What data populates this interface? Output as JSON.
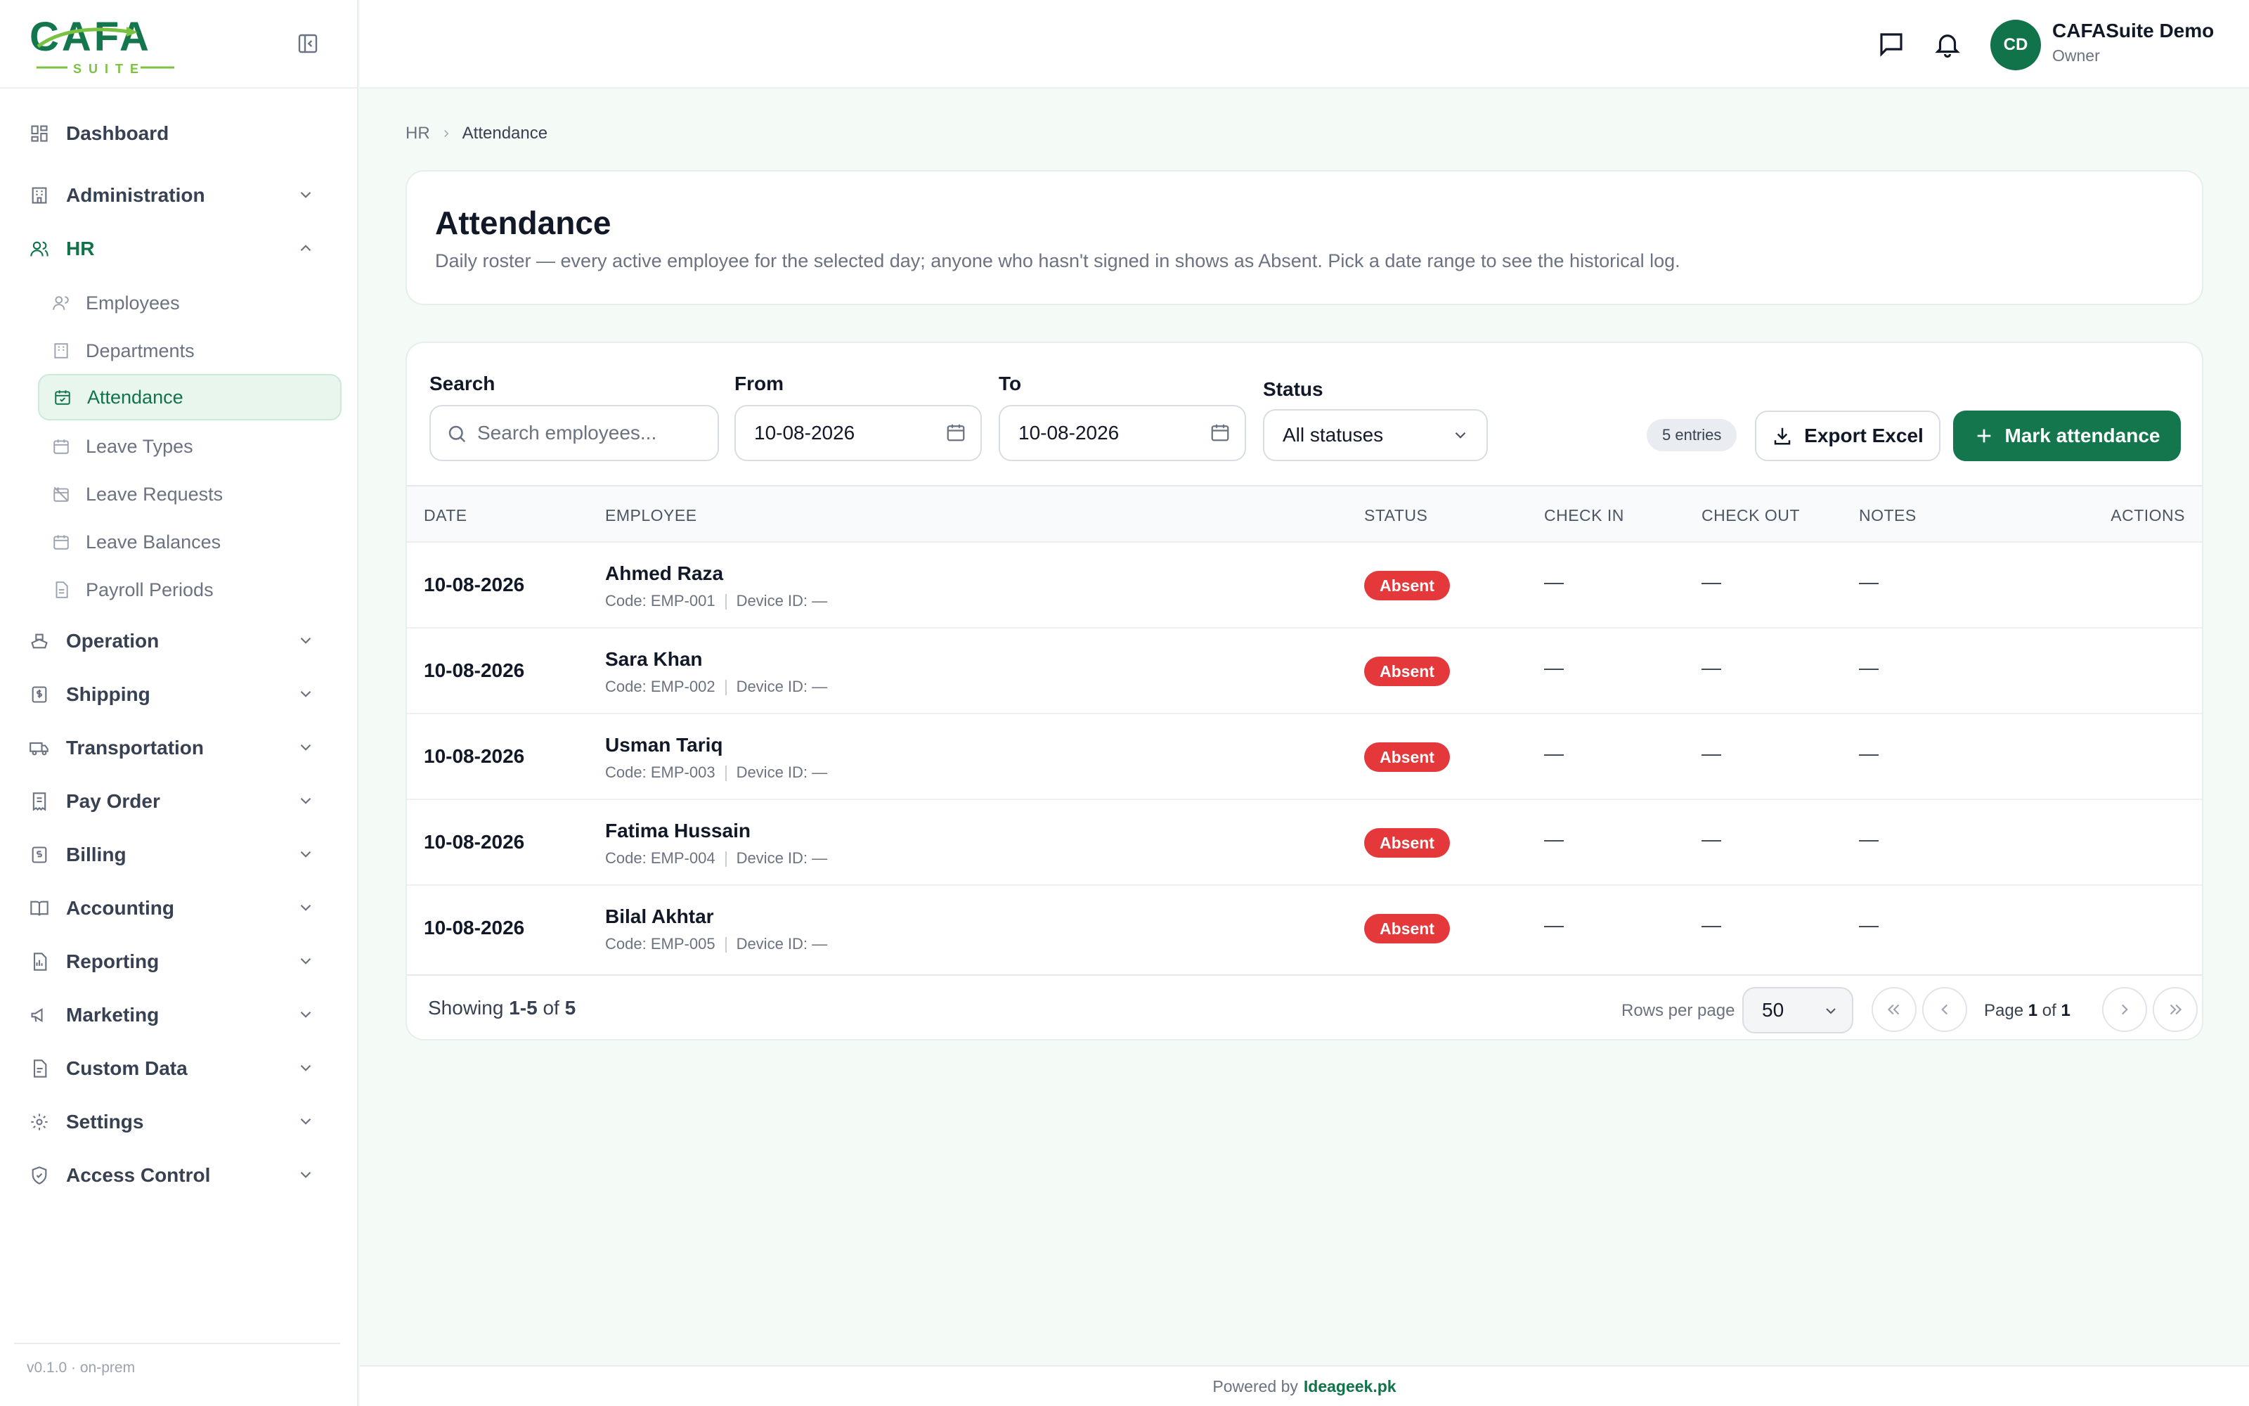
{
  "app": {
    "logo_text": "CAFA",
    "logo_subtext": "SUITE",
    "version": "v0.1.0 · on-prem",
    "brand_color": "#13764c",
    "footer_prefix": "Powered by",
    "footer_link": "Ideageek.pk"
  },
  "sidebar": {
    "items": [
      {
        "label": "Dashboard",
        "icon": "dashboard-icon"
      },
      {
        "label": "Administration",
        "icon": "building-icon"
      },
      {
        "label": "HR",
        "icon": "users-icon"
      },
      {
        "label": "Operation",
        "icon": "ship-icon"
      },
      {
        "label": "Shipping",
        "icon": "dollar-receipt-icon"
      },
      {
        "label": "Transportation",
        "icon": "truck-icon"
      },
      {
        "label": "Pay Order",
        "icon": "receipt-icon"
      },
      {
        "label": "Billing",
        "icon": "billing-icon"
      },
      {
        "label": "Accounting",
        "icon": "book-icon"
      },
      {
        "label": "Reporting",
        "icon": "report-icon"
      },
      {
        "label": "Marketing",
        "icon": "megaphone-icon"
      },
      {
        "label": "Custom Data",
        "icon": "database-icon"
      },
      {
        "label": "Settings",
        "icon": "gear-icon"
      },
      {
        "label": "Access Control",
        "icon": "shield-icon"
      }
    ],
    "hr_subitems": [
      {
        "label": "Employees",
        "icon": "user-icon"
      },
      {
        "label": "Departments",
        "icon": "building-icon"
      },
      {
        "label": "Attendance",
        "icon": "calendar-check-icon",
        "active": true
      },
      {
        "label": "Leave Types",
        "icon": "calendar-icon"
      },
      {
        "label": "Leave Requests",
        "icon": "calendar-off-icon"
      },
      {
        "label": "Leave Balances",
        "icon": "calendar-icon"
      },
      {
        "label": "Payroll Periods",
        "icon": "file-icon"
      }
    ]
  },
  "header": {
    "user_initials": "CD",
    "user_name": "CAFASuite Demo",
    "user_role": "Owner"
  },
  "breadcrumb": {
    "parent": "HR",
    "current": "Attendance"
  },
  "page": {
    "title": "Attendance",
    "subtitle": "Daily roster — every active employee for the selected day; anyone who hasn't signed in shows as Absent. Pick a date range to see the historical log."
  },
  "filters": {
    "search_label": "Search",
    "search_placeholder": "Search employees...",
    "from_label": "From",
    "from_value": "10-08-2026",
    "to_label": "To",
    "to_value": "10-08-2026",
    "status_label": "Status",
    "status_value": "All statuses",
    "entries": "5 entries",
    "export_label": "Export Excel",
    "mark_label": "Mark attendance"
  },
  "table": {
    "columns": [
      "DATE",
      "EMPLOYEE",
      "STATUS",
      "CHECK IN",
      "CHECK OUT",
      "NOTES",
      "ACTIONS"
    ],
    "code_prefix": "Code:",
    "device_prefix": "Device ID:",
    "rows": [
      {
        "date": "10-08-2026",
        "name": "Ahmed Raza",
        "code": "EMP-001",
        "device": "—",
        "status": "Absent",
        "check_in": "—",
        "check_out": "—",
        "notes": "—"
      },
      {
        "date": "10-08-2026",
        "name": "Sara Khan",
        "code": "EMP-002",
        "device": "—",
        "status": "Absent",
        "check_in": "—",
        "check_out": "—",
        "notes": "—"
      },
      {
        "date": "10-08-2026",
        "name": "Usman Tariq",
        "code": "EMP-003",
        "device": "—",
        "status": "Absent",
        "check_in": "—",
        "check_out": "—",
        "notes": "—"
      },
      {
        "date": "10-08-2026",
        "name": "Fatima Hussain",
        "code": "EMP-004",
        "device": "—",
        "status": "Absent",
        "check_in": "—",
        "check_out": "—",
        "notes": "—"
      },
      {
        "date": "10-08-2026",
        "name": "Bilal Akhtar",
        "code": "EMP-005",
        "device": "—",
        "status": "Absent",
        "check_in": "—",
        "check_out": "—",
        "notes": "—"
      }
    ],
    "status_color": "#e5383b"
  },
  "pagination": {
    "showing_prefix": "Showing",
    "showing_range": "1-5",
    "showing_of": "of",
    "showing_total": "5",
    "rows_per_page_label": "Rows per page",
    "rows_per_page": "50",
    "page_prefix": "Page",
    "page_current": "1",
    "page_of": "of",
    "page_total": "1"
  }
}
